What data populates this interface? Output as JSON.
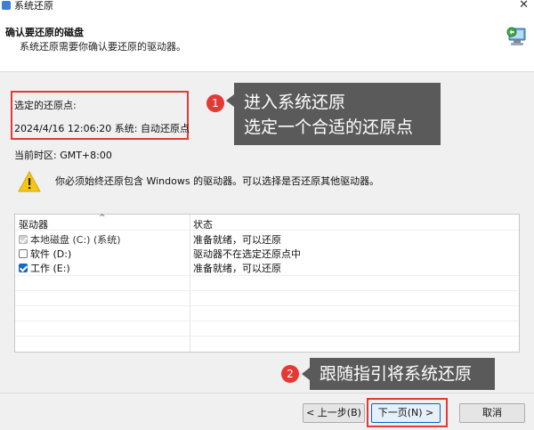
{
  "window": {
    "title": "系统还原",
    "close_glyph": "✕"
  },
  "header": {
    "title": "确认要还原的磁盘",
    "subtitle": "系统还原需要你确认要还原的驱动器。"
  },
  "restore_point": {
    "label": "选定的还原点:",
    "value": "2024/4/16 12:06:20 系统: 自动还原点"
  },
  "timezone": "当前时区: GMT+8:00",
  "warning": {
    "icon": "warning-icon",
    "text": "你必须始终还原包含 Windows 的驱动器。可以选择是否还原其他驱动器。"
  },
  "drive_table": {
    "columns": [
      "驱动器",
      "状态"
    ],
    "sort_glyph": "^",
    "rows": [
      {
        "drive": "本地磁盘 (C:) (系统)",
        "status": "准备就绪，可以还原",
        "checked": true,
        "disabled": true
      },
      {
        "drive": "软件 (D:)",
        "status": "驱动器不在选定还原点中",
        "checked": false,
        "disabled": false
      },
      {
        "drive": "工作 (E:)",
        "status": "准备就绪，可以还原",
        "checked": true,
        "disabled": false
      }
    ]
  },
  "buttons": {
    "back": "< 上一步(B)",
    "next": "下一页(N) >",
    "cancel": "取消"
  },
  "annotations": {
    "step1": {
      "number": "1",
      "lines": [
        "进入系统还原",
        "选定一个合适的还原点"
      ]
    },
    "step2": {
      "number": "2",
      "lines": [
        "跟随指引将系统还原"
      ]
    }
  },
  "colors": {
    "highlight_red": "#e53935",
    "callout_gray": "#5a5a5a",
    "accent_blue": "#1769c7"
  }
}
